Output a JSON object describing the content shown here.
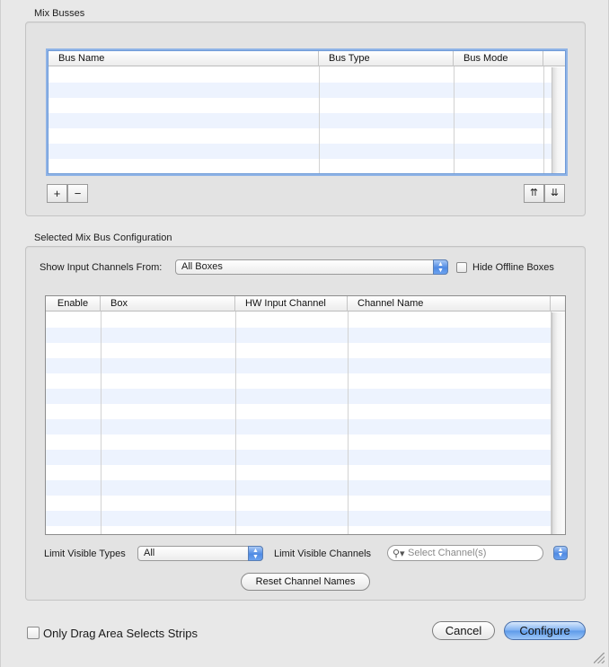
{
  "mix_busses": {
    "title": "Mix Busses",
    "columns": [
      "Bus Name",
      "Bus Type",
      "Bus Mode"
    ],
    "rows": 7,
    "add_label": "+",
    "remove_label": "−",
    "move_up_label": "⇈",
    "move_down_label": "⇊"
  },
  "config": {
    "title": "Selected Mix Bus Configuration",
    "show_from_label": "Show Input Channels From:",
    "show_from_value": "All Boxes",
    "hide_offline_label": "Hide Offline Boxes",
    "columns": [
      "Enable",
      "Box",
      "HW Input Channel",
      "Channel Name"
    ],
    "rows": 14,
    "limit_types_label": "Limit Visible Types",
    "limit_types_value": "All",
    "limit_channels_label": "Limit Visible Channels",
    "channel_search_placeholder": "Select Channel(s)",
    "reset_label": "Reset Channel Names"
  },
  "footer": {
    "drag_area_label": "Only Drag Area Selects Strips",
    "cancel_label": "Cancel",
    "configure_label": "Configure"
  },
  "colors": {
    "accent": "#5d9ae9",
    "alt_row": "#edf3fe"
  }
}
